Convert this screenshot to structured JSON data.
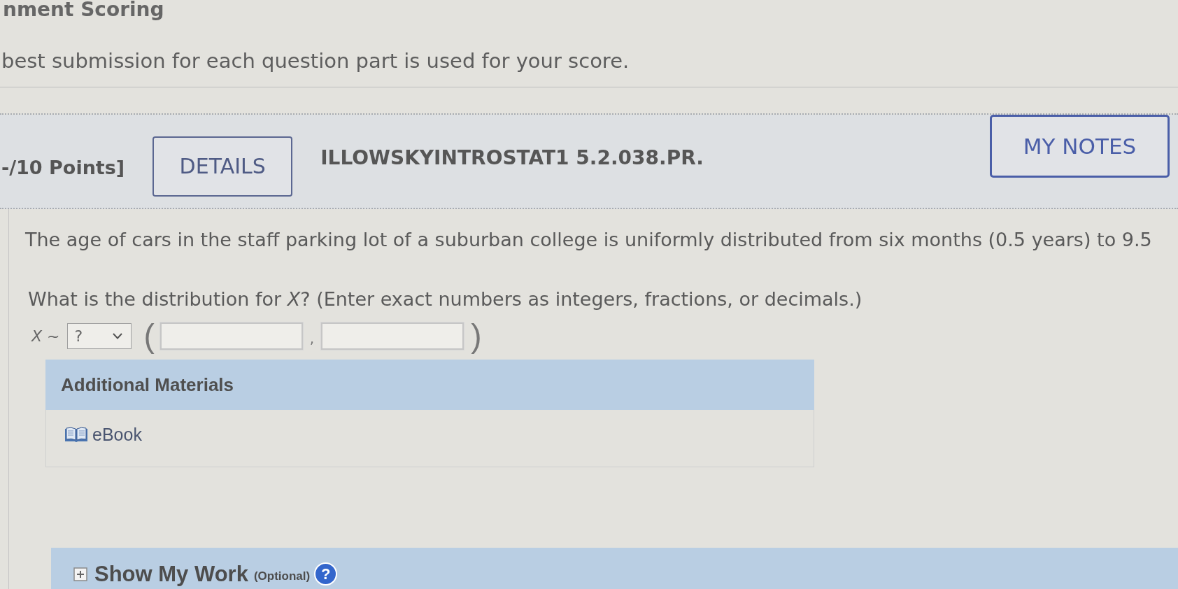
{
  "header": {
    "title": "nment Scoring",
    "note": "best submission for each question part is used for your score."
  },
  "question_bar": {
    "points": "-/10 Points]",
    "details_button": "DETAILS",
    "question_id": "ILLOWSKYINTROSTAT1 5.2.038.PR.",
    "notes_button": "MY NOTES"
  },
  "question": {
    "prompt": "The age of cars in the staff parking lot of a suburban college is uniformly distributed from six months (0.5 years) to 9.5",
    "instruction": "What is the distribution for *X*? (Enter exact numbers as integers, fractions, or decimals.)",
    "answer_row": [
      {
        "kind": "text",
        "text": "*X* ~"
      },
      {
        "kind": "select",
        "value": "?"
      },
      {
        "kind": "bracket",
        "text": "("
      },
      {
        "kind": "field"
      },
      {
        "kind": "separator",
        "text": ","
      },
      {
        "kind": "field"
      },
      {
        "kind": "bracket",
        "text": ")"
      }
    ]
  },
  "additional_materials": {
    "title": "Additional Materials",
    "items": [
      {
        "label": "eBook"
      }
    ]
  },
  "show_my_work": {
    "label": "Show My Work",
    "note": "(Optional)",
    "help": "?",
    "expanded": false
  }
}
